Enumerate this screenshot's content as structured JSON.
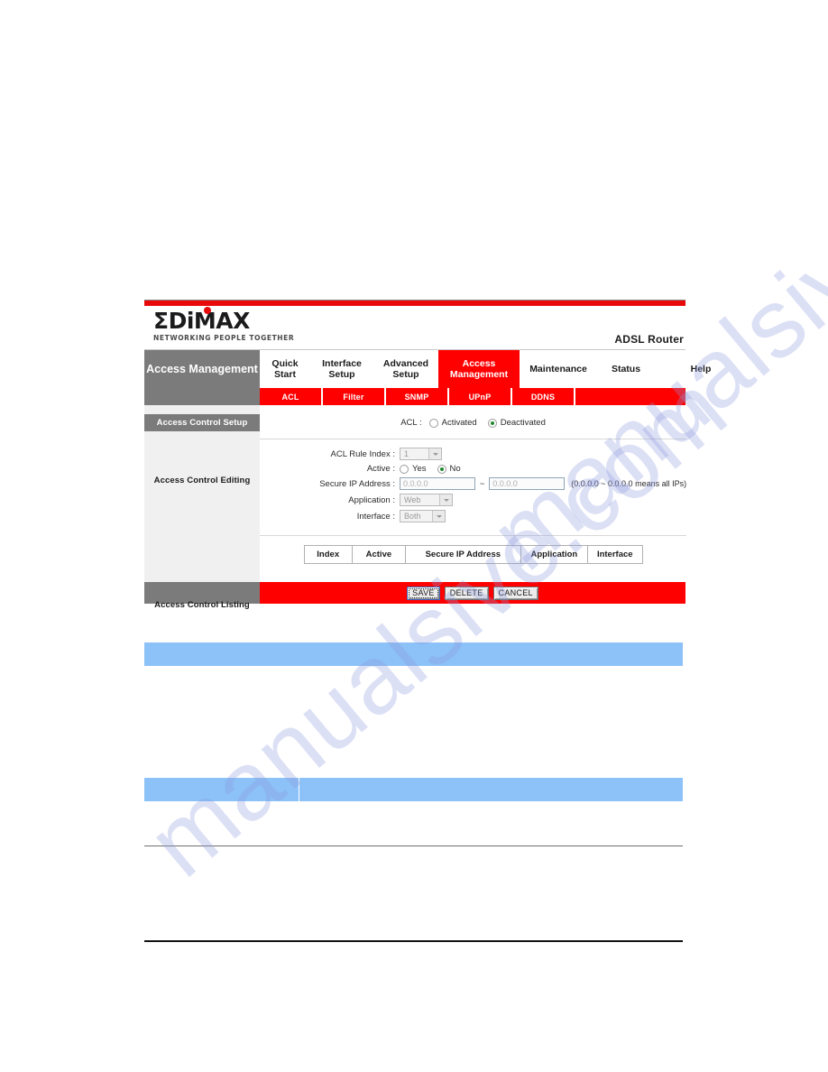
{
  "watermark": {
    "line_a": "manualsive.com",
    "line_b": "manualsive.com"
  },
  "router_ui": {
    "brand": {
      "wordmark": "ΣDiMAX",
      "tagline": "NETWORKING PEOPLE TOGETHER",
      "device_label": "ADSL Router"
    },
    "sidebar": {
      "title": "Access Management",
      "section_header": "Access Control Setup",
      "editing_label": "Access Control Editing",
      "listing_label": "Access Control Listing"
    },
    "main_nav": [
      {
        "label": "Quick Start",
        "active": false
      },
      {
        "label": "Interface Setup",
        "active": false
      },
      {
        "label": "Advanced Setup",
        "active": false
      },
      {
        "label": "Access Management",
        "active": true
      },
      {
        "label": "Maintenance",
        "active": false
      },
      {
        "label": "Status",
        "active": false
      },
      {
        "label": "Help",
        "active": false
      }
    ],
    "sub_nav": [
      {
        "label": "ACL",
        "active": true
      },
      {
        "label": "Filter",
        "active": false
      },
      {
        "label": "SNMP",
        "active": false
      },
      {
        "label": "UPnP",
        "active": false
      },
      {
        "label": "DDNS",
        "active": false
      }
    ],
    "acl_setup": {
      "label": "ACL :",
      "option_activated": "Activated",
      "option_deactivated": "Deactivated",
      "selected": "Deactivated"
    },
    "editing_form": {
      "rule_index_label": "ACL Rule Index :",
      "rule_index_value": "1",
      "active_label": "Active :",
      "active_yes": "Yes",
      "active_no": "No",
      "active_selected": "No",
      "secure_ip_label": "Secure IP Address :",
      "secure_ip_start": "0.0.0.0",
      "secure_ip_separator": "~",
      "secure_ip_end": "0.0.0.0",
      "secure_ip_hint": "(0.0.0.0 ~ 0.0.0.0 means all IPs)",
      "application_label": "Application :",
      "application_value": "Web",
      "interface_label": "Interface :",
      "interface_value": "Both"
    },
    "listing_table": {
      "headers": [
        "Index",
        "Active",
        "Secure IP Address",
        "Application",
        "Interface"
      ],
      "rows": []
    },
    "footer_buttons": [
      {
        "label": "SAVE",
        "focused": true
      },
      {
        "label": "DELETE",
        "focused": false
      },
      {
        "label": "CANCEL",
        "focused": false
      }
    ],
    "colors": {
      "brand_red": "#ff0000",
      "nav_grey": "#7b7b7b",
      "panel_grey": "#f0f0f0",
      "doc_blue": "#8cc2f7"
    }
  }
}
